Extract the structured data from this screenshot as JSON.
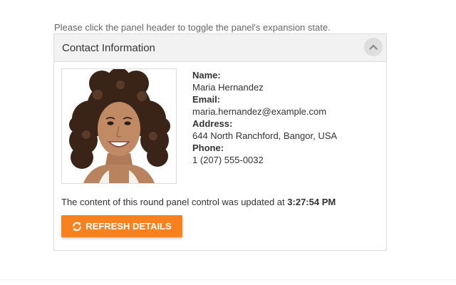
{
  "instructions": "Please click the panel header to toggle the panel's expansion state.",
  "panel": {
    "title": "Contact Information",
    "toggle_icon": "chevron-up-icon",
    "expanded": true,
    "photo_icon": "contact-photo"
  },
  "contact": {
    "name_label": "Name:",
    "name": "Maria Hernandez",
    "email_label": "Email:",
    "email": "maria.hernandez@example.com",
    "address_label": "Address:",
    "address": "644 North Ranchford, Bangor, USA",
    "phone_label": "Phone:",
    "phone": "1 (207) 555-0032"
  },
  "status": {
    "text": "The content of this round panel control was updated at",
    "time": "3:27:54 PM"
  },
  "refresh_button": {
    "label": "REFRESH DETAILS",
    "icon": "refresh-icon",
    "color": "#f7811e"
  },
  "colors": {
    "header_bg": "#f2f2f2",
    "border": "#dcdcdc",
    "accent": "#f7811e"
  }
}
